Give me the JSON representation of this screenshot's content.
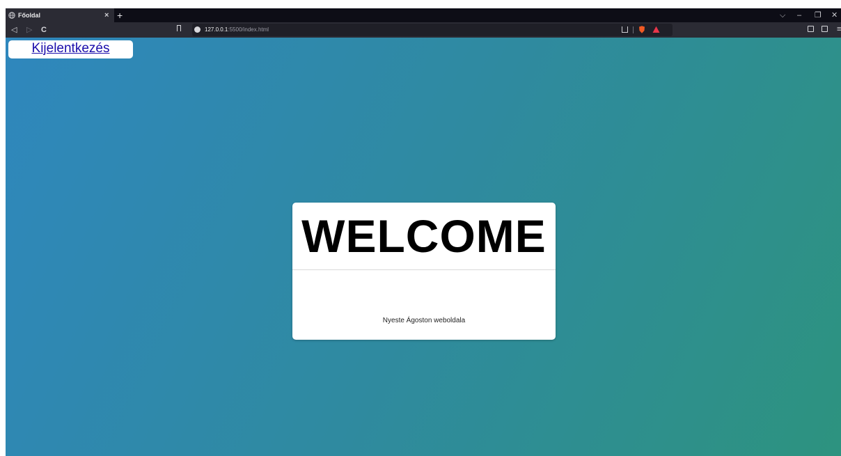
{
  "browser": {
    "tab_title": "Főoldal",
    "tab_close": "×",
    "new_tab": "+",
    "url_host": "127.0.0.1",
    "url_rest": ":5500/index.html",
    "window_controls": {
      "dropdown": "⌵",
      "minimize": "–",
      "restore": "❐",
      "close": "✕"
    },
    "nav": {
      "back": "◁",
      "forward": "▷",
      "reload": "C"
    },
    "menu": "≡"
  },
  "page": {
    "logout_link": "Kijelentkezés",
    "welcome_title": "WELCOME",
    "subtitle": "Nyeste Ágoston weboldala"
  },
  "colors": {
    "gradient_start": "#2f87bd",
    "gradient_end": "#2d937f",
    "link": "#1a0dab",
    "browser_chrome": "#2b2b34"
  }
}
